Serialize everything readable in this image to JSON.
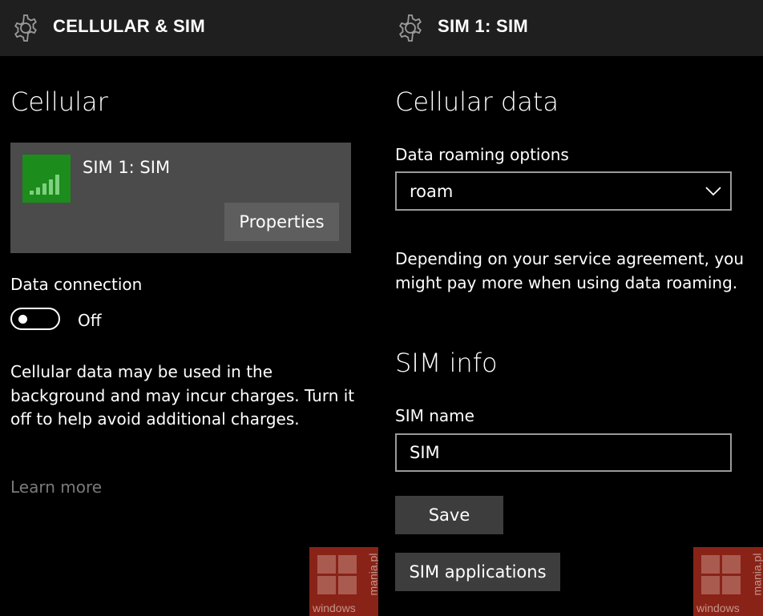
{
  "left": {
    "header": {
      "title": "CELLULAR & SIM",
      "icon": "gear-icon"
    },
    "section_title": "Cellular",
    "sim_card": {
      "name": "SIM 1: SIM",
      "signal_bars": 5,
      "icon_color": "#1c8c1c",
      "properties_label": "Properties"
    },
    "data_connection": {
      "label": "Data connection",
      "state": "Off"
    },
    "description": "Cellular data may be used in the background and may incur charges. Turn it off to help avoid additional charges.",
    "learn_more": "Learn more"
  },
  "right": {
    "header": {
      "title": "SIM 1: SIM",
      "icon": "gear-icon"
    },
    "cellular_data_title": "Cellular data",
    "roaming": {
      "label": "Data roaming options",
      "value": "roam"
    },
    "roaming_note": "Depending on your service agreement, you might pay more when using data roaming.",
    "sim_info_title": "SIM info",
    "sim_name": {
      "label": "SIM name",
      "value": "SIM"
    },
    "save_label": "Save",
    "sim_applications_label": "SIM applications"
  },
  "watermark": {
    "text_bottom": "windows",
    "text_side": "mania.pl",
    "color": "#a12a1c"
  }
}
